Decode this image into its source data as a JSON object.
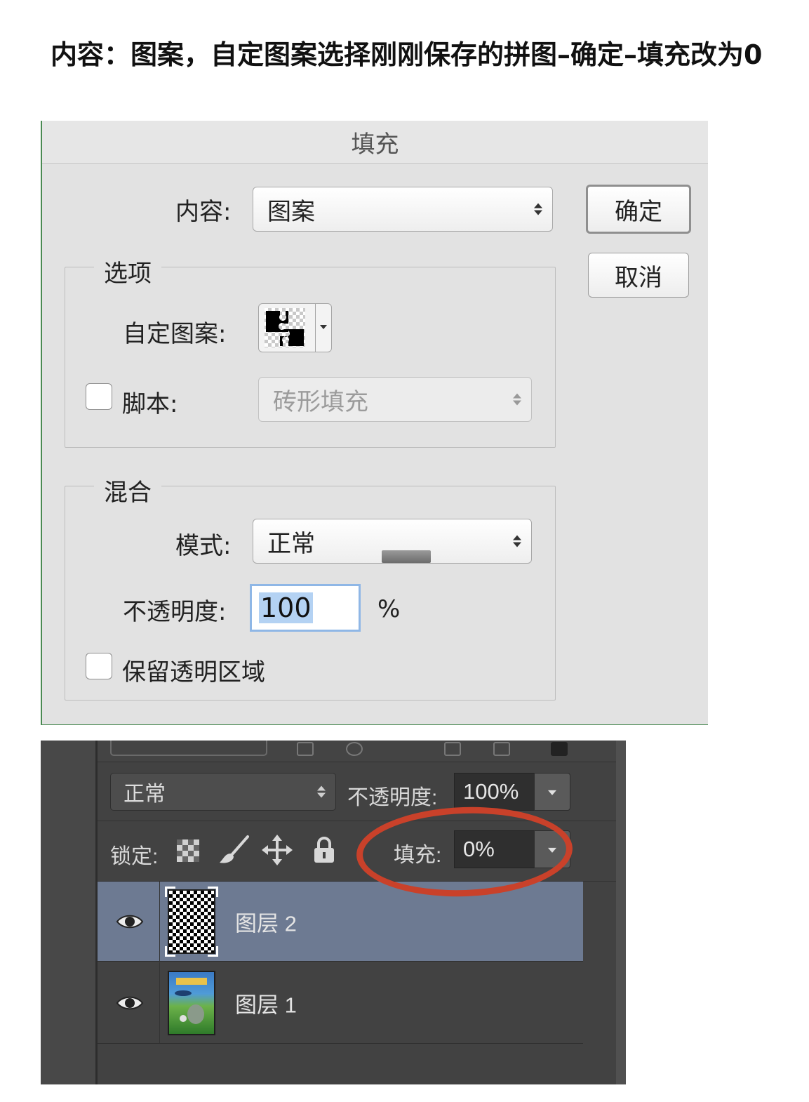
{
  "instruction": "内容：图案，自定图案选择刚刚保存的拼图–确定–填充改为0",
  "dialog": {
    "title": "填充",
    "content_label": "内容:",
    "content_value": "图案",
    "ok_label": "确定",
    "cancel_label": "取消",
    "options": {
      "legend": "选项",
      "custom_pattern_label": "自定图案:",
      "script_label": "脚本:",
      "script_value": "砖形填充",
      "script_checked": false
    },
    "blend": {
      "legend": "混合",
      "mode_label": "模式:",
      "mode_value": "正常",
      "opacity_label": "不透明度:",
      "opacity_value": "100",
      "opacity_unit": "%",
      "preserve_label": "保留透明区域",
      "preserve_checked": false
    }
  },
  "layers_panel": {
    "blend_mode": "正常",
    "opacity_label": "不透明度:",
    "opacity_value": "100%",
    "lock_label": "锁定:",
    "fill_label": "填充:",
    "fill_value": "0%",
    "highlight_color": "#c9412a",
    "lock_icons": [
      "lock-transparent-icon",
      "lock-brush-icon",
      "lock-move-icon",
      "lock-all-icon"
    ],
    "layers": [
      {
        "name": "图层 2",
        "selected": true,
        "thumbnail": "checker-pattern"
      },
      {
        "name": "图层 1",
        "selected": false,
        "thumbnail": "totoro-poster"
      }
    ]
  }
}
